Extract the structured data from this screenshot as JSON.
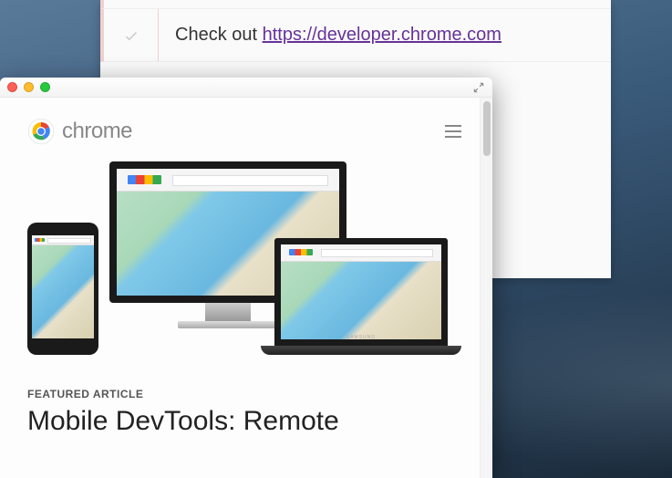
{
  "note": {
    "text_prefix": "Check out ",
    "link_text": "https://developer.chrome.com",
    "link_href": "https://developer.chrome.com"
  },
  "popup": {
    "brand": "chrome",
    "featured_label": "FEATURED ARTICLE",
    "article_title": "Mobile DevTools: Remote",
    "laptop_brand": "SAMSUNG"
  }
}
